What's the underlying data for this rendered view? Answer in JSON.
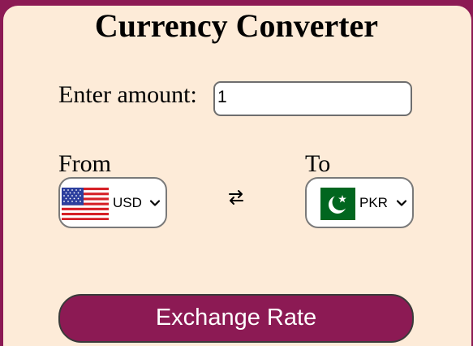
{
  "app": {
    "title": "Currency Converter"
  },
  "amount": {
    "label": "Enter amount:",
    "value": "1"
  },
  "from": {
    "label": "From",
    "currency": "USD",
    "flag_icon": "us-flag-icon"
  },
  "to": {
    "label": "To",
    "currency": "PKR",
    "flag_icon": "pakistan-flag-icon"
  },
  "swap_icon": "swap-arrows-icon",
  "button": {
    "label": "Exchange Rate"
  },
  "colors": {
    "background": "#8c1a54",
    "card": "#fdebd8",
    "button": "#8c1a54",
    "button_text": "#ffffff"
  }
}
